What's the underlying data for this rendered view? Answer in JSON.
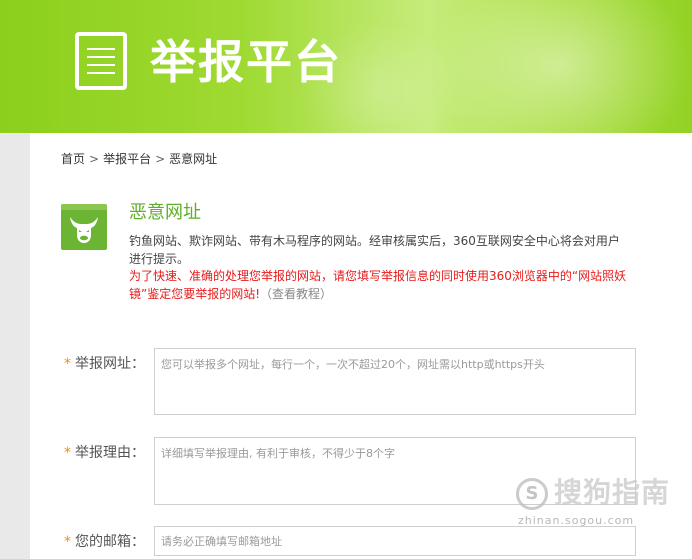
{
  "banner": {
    "title": "举报平台",
    "icon": "document-icon"
  },
  "breadcrumb": {
    "items": [
      "首页",
      "举报平台",
      "恶意网址"
    ],
    "separator": ">"
  },
  "category": {
    "icon": "bull-head-icon",
    "title": "恶意网址",
    "description": "钓鱼网站、欺诈网站、带有木马程序的网站。经审核属实后，360互联网安全中心将会对用户进行提示。",
    "warning": "为了快速、准确的处理您举报的网站，请您填写举报信息的同时使用360浏览器中的“网站照妖镜”鉴定您要举报的网站!",
    "tutorial_link": "（查看教程）"
  },
  "form": {
    "required_mark": "*",
    "url_label": "举报网址：",
    "url_placeholder": "您可以举报多个网址，每行一个，一次不超过20个，网址需以http或https开头",
    "reason_label": "举报理由：",
    "reason_placeholder": "详细填写举报理由, 有利于审核，不得少于8个字",
    "email_label": "您的邮箱：",
    "email_placeholder": "请务必正确填写邮箱地址"
  },
  "watermark": {
    "logo_letter": "S",
    "text": "搜狗指南",
    "url": "zhinan.sogou.com"
  },
  "colors": {
    "banner_green": "#9fda32",
    "accent_green": "#5fae28",
    "warning_red": "#e61b1b",
    "required_orange": "#f08c14"
  }
}
